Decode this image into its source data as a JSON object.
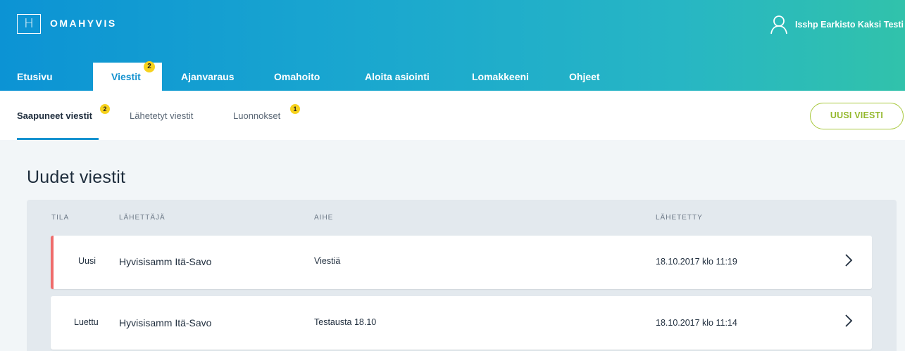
{
  "header": {
    "logo_letter": "H",
    "brand": "OMAHYVIS",
    "user_name": "Isshp Earkisto Kaksi Testi",
    "icon": "user-icon"
  },
  "nav": {
    "items": [
      {
        "label": "Etusivu",
        "active": false
      },
      {
        "label": "Viestit",
        "active": true,
        "badge": "2"
      },
      {
        "label": "Ajanvaraus",
        "active": false
      },
      {
        "label": "Omahoito",
        "active": false
      },
      {
        "label": "Aloita asiointi",
        "active": false
      },
      {
        "label": "Lomakkeeni",
        "active": false
      },
      {
        "label": "Ohjeet",
        "active": false
      }
    ]
  },
  "subnav": {
    "items": [
      {
        "label": "Saapuneet viestit",
        "active": true,
        "badge": "2"
      },
      {
        "label": "Lähetetyt viestit",
        "active": false
      },
      {
        "label": "Luonnokset",
        "active": false,
        "badge": "1"
      }
    ],
    "new_message_label": "UUSI VIESTI"
  },
  "content": {
    "title": "Uudet viestit",
    "columns": [
      "TILA",
      "LÄHETTÄJÄ",
      "AIHE",
      "LÄHETETTY"
    ],
    "rows": [
      {
        "status": "Uusi",
        "sender": "Hyvisisamm Itä-Savo",
        "subject": "Viestiä",
        "sent": "18.10.2017 klo 11:19",
        "unread": true
      },
      {
        "status": "Luettu",
        "sender": "Hyvisisamm Itä-Savo",
        "subject": "Testausta 18.10",
        "sent": "18.10.2017 klo 11:14",
        "unread": false
      }
    ]
  },
  "colors": {
    "accent_blue": "#1592cf",
    "badge_yellow": "#f7d21d",
    "unread_red": "#ef6b6b",
    "button_green": "#a9c93f"
  }
}
